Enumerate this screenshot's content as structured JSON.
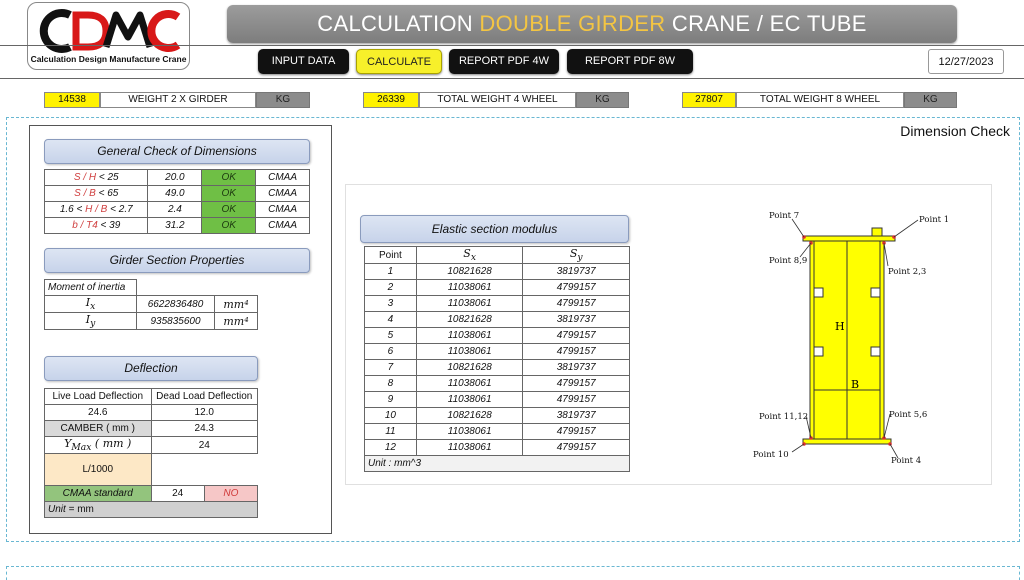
{
  "logo": {
    "letters": "CDMC",
    "tagline": "Calculation Design Manufacture Crane"
  },
  "title": {
    "prefix": "CALCULATION",
    "accent": "DOUBLE GIRDER",
    "suffix": "CRANE / EC TUBE"
  },
  "nav": {
    "input_data": "INPUT DATA",
    "calculate": "CALCULATE",
    "report_4w": "REPORT PDF 4W",
    "report_8w": "REPORT PDF 8W"
  },
  "date": "12/27/2023",
  "weights": [
    {
      "value": "14538",
      "label": "WEIGHT 2 X GIRDER",
      "unit": "KG"
    },
    {
      "value": "26339",
      "label": "TOTAL WEIGHT 4 WHEEL",
      "unit": "KG"
    },
    {
      "value": "27807",
      "label": "TOTAL WEIGHT 8 WHEEL",
      "unit": "KG"
    }
  ],
  "dimension_check_title": "Dimension Check",
  "general_check": {
    "title": "General Check of Dimensions",
    "rows": [
      {
        "pre": "",
        "ratio": "S / H",
        "cond": " < 25",
        "value": "20.0",
        "status": "OK",
        "std": "CMAA"
      },
      {
        "pre": "",
        "ratio": "S / B",
        "cond": " < 65",
        "value": "49.0",
        "status": "OK",
        "std": "CMAA"
      },
      {
        "pre": "1.6 < ",
        "ratio": "H / B",
        "cond": " < 2.7",
        "value": "2.4",
        "status": "OK",
        "std": "CMAA"
      },
      {
        "pre": "",
        "ratio": "b / T4",
        "cond": " < 39",
        "value": "31.2",
        "status": "OK",
        "std": "CMAA"
      }
    ]
  },
  "section_props": {
    "title": "Girder Section Properties",
    "moment_label": "Moment of inertia",
    "ix_sym": "I",
    "ix_sub": "x",
    "ix_val": "6622836480",
    "iy_sym": "I",
    "iy_sub": "y",
    "iy_val": "935835600",
    "unit": "mm⁴"
  },
  "deflection": {
    "title": "Deflection",
    "live_label": "Live Load Deflection",
    "dead_label": "Dead Load Deflection",
    "live_val": "24.6",
    "dead_val": "12.0",
    "camber_label": "CAMBER ( mm )",
    "camber_val": "24.3",
    "ymax_sym": "Y",
    "ymax_sub": "Max",
    "ymax_unit": " ( mm )",
    "ymax_val": "24",
    "ratio_label": "L/1000",
    "cmaa_label": "CMAA standard",
    "cmaa_val": "24",
    "cmaa_status": "NO",
    "unit_prefix": "Unit = ",
    "unit_value": "mm"
  },
  "elastic": {
    "title": "Elastic section modulus",
    "col_point": "Point",
    "col_sx_sym": "S",
    "col_sx_sub": "x",
    "col_sy_sym": "S",
    "col_sy_sub": "y",
    "rows": [
      {
        "point": "1",
        "sx": "10821628",
        "sy": "3819737"
      },
      {
        "point": "2",
        "sx": "11038061",
        "sy": "4799157"
      },
      {
        "point": "3",
        "sx": "11038061",
        "sy": "4799157"
      },
      {
        "point": "4",
        "sx": "10821628",
        "sy": "3819737"
      },
      {
        "point": "5",
        "sx": "11038061",
        "sy": "4799157"
      },
      {
        "point": "6",
        "sx": "11038061",
        "sy": "4799157"
      },
      {
        "point": "7",
        "sx": "10821628",
        "sy": "3819737"
      },
      {
        "point": "8",
        "sx": "11038061",
        "sy": "4799157"
      },
      {
        "point": "9",
        "sx": "11038061",
        "sy": "4799157"
      },
      {
        "point": "10",
        "sx": "10821628",
        "sy": "3819737"
      },
      {
        "point": "11",
        "sx": "11038061",
        "sy": "4799157"
      },
      {
        "point": "12",
        "sx": "11038061",
        "sy": "4799157"
      }
    ],
    "unit": "Unit : mm^3"
  },
  "diagram": {
    "h_label": "H",
    "b_label": "B",
    "points": {
      "p1": "Point 1",
      "p7": "Point 7",
      "p89": "Point 8,9",
      "p23": "Point 2,3",
      "p1112": "Point 11,12",
      "p56": "Point 5,6",
      "p10": "Point 10",
      "p4": "Point 4"
    },
    "colors": {
      "web": "#ffff00",
      "flange": "#ffff00",
      "stroke": "#333333",
      "marker": "#e03030"
    }
  }
}
